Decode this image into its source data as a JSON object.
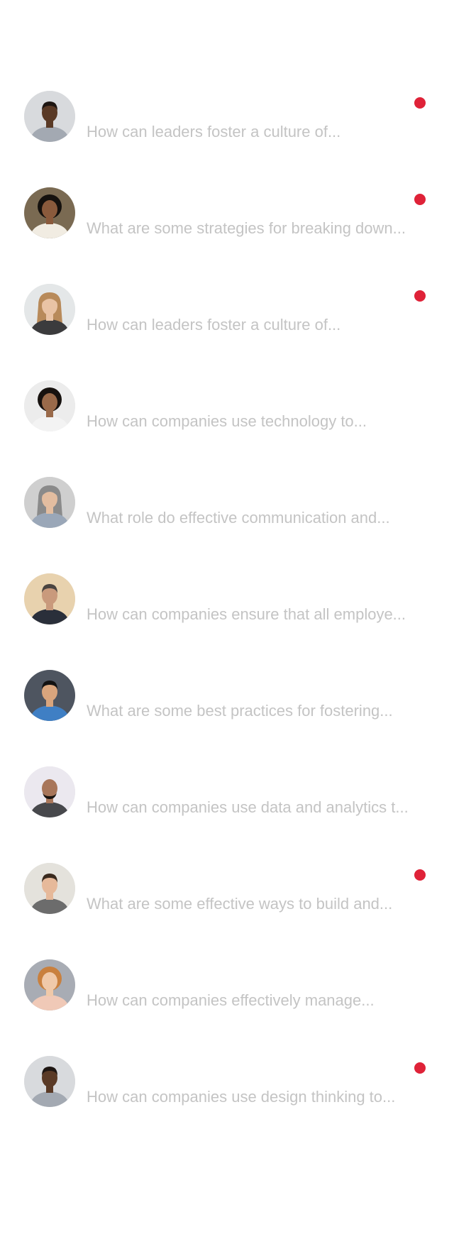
{
  "conversations": [
    {
      "preview": "How can leaders foster a culture of...",
      "unread": true,
      "avatar": {
        "bg": "#d8dadd",
        "skin": "#5a3a26",
        "hair": "#1e1612",
        "shirt": "#a3a9b2",
        "hair_style": "short"
      }
    },
    {
      "preview": "What are some strategies for breaking down...",
      "unread": true,
      "avatar": {
        "bg": "#7a6a52",
        "skin": "#8a5a3c",
        "hair": "#15110e",
        "shirt": "#f1ece2",
        "hair_style": "curly"
      }
    },
    {
      "preview": "How can leaders foster a culture of...",
      "unread": true,
      "avatar": {
        "bg": "#e4e7e8",
        "skin": "#e9c3a5",
        "hair": "#b88a5a",
        "shirt": "#3b3b3d",
        "hair_style": "long"
      }
    },
    {
      "preview": "How can companies use technology to...",
      "unread": false,
      "avatar": {
        "bg": "#ececec",
        "skin": "#9a6a4a",
        "hair": "#17120f",
        "shirt": "#f3f3f3",
        "hair_style": "curly"
      }
    },
    {
      "preview": "What role do effective communication and...",
      "unread": false,
      "avatar": {
        "bg": "#cfcfcf",
        "skin": "#e3bda0",
        "hair": "#8a8a8a",
        "shirt": "#9aa7b8",
        "hair_style": "long"
      }
    },
    {
      "preview": "How can companies ensure that all employe...",
      "unread": false,
      "avatar": {
        "bg": "#e8d2ae",
        "skin": "#c99a7c",
        "hair": "#4a4440",
        "shirt": "#2a2f3a",
        "hair_style": "short"
      }
    },
    {
      "preview": "What are some best practices for fostering...",
      "unread": false,
      "avatar": {
        "bg": "#4e5560",
        "skin": "#d9a57d",
        "hair": "#121212",
        "shirt": "#3f7fc4",
        "hair_style": "short"
      }
    },
    {
      "preview": "How can companies use data and analytics t...",
      "unread": false,
      "avatar": {
        "bg": "#ebe8ef",
        "skin": "#a8765a",
        "hair": "#1a1410",
        "shirt": "#47484c",
        "hair_style": "bald"
      }
    },
    {
      "preview": "What are some effective ways to build and...",
      "unread": true,
      "avatar": {
        "bg": "#e4e2dc",
        "skin": "#e6b99a",
        "hair": "#3a2a1e",
        "shirt": "#6c6c6c",
        "hair_style": "short"
      }
    },
    {
      "preview": "How can companies effectively manage...",
      "unread": false,
      "avatar": {
        "bg": "#a8acb4",
        "skin": "#f0c9a9",
        "hair": "#c9803e",
        "shirt": "#f0c9b7",
        "hair_style": "curly"
      }
    },
    {
      "preview": "How can companies use design thinking to...",
      "unread": true,
      "avatar": {
        "bg": "#d8dadd",
        "skin": "#5a3a26",
        "hair": "#1e1612",
        "shirt": "#a3a9b2",
        "hair_style": "short"
      }
    }
  ],
  "colors": {
    "unread_dot": "#df2238",
    "preview_text": "#c4c4c4",
    "background": "#ffffff"
  },
  "icons": {
    "avatar": "person-avatar-icon",
    "unread": "unread-dot-icon"
  }
}
